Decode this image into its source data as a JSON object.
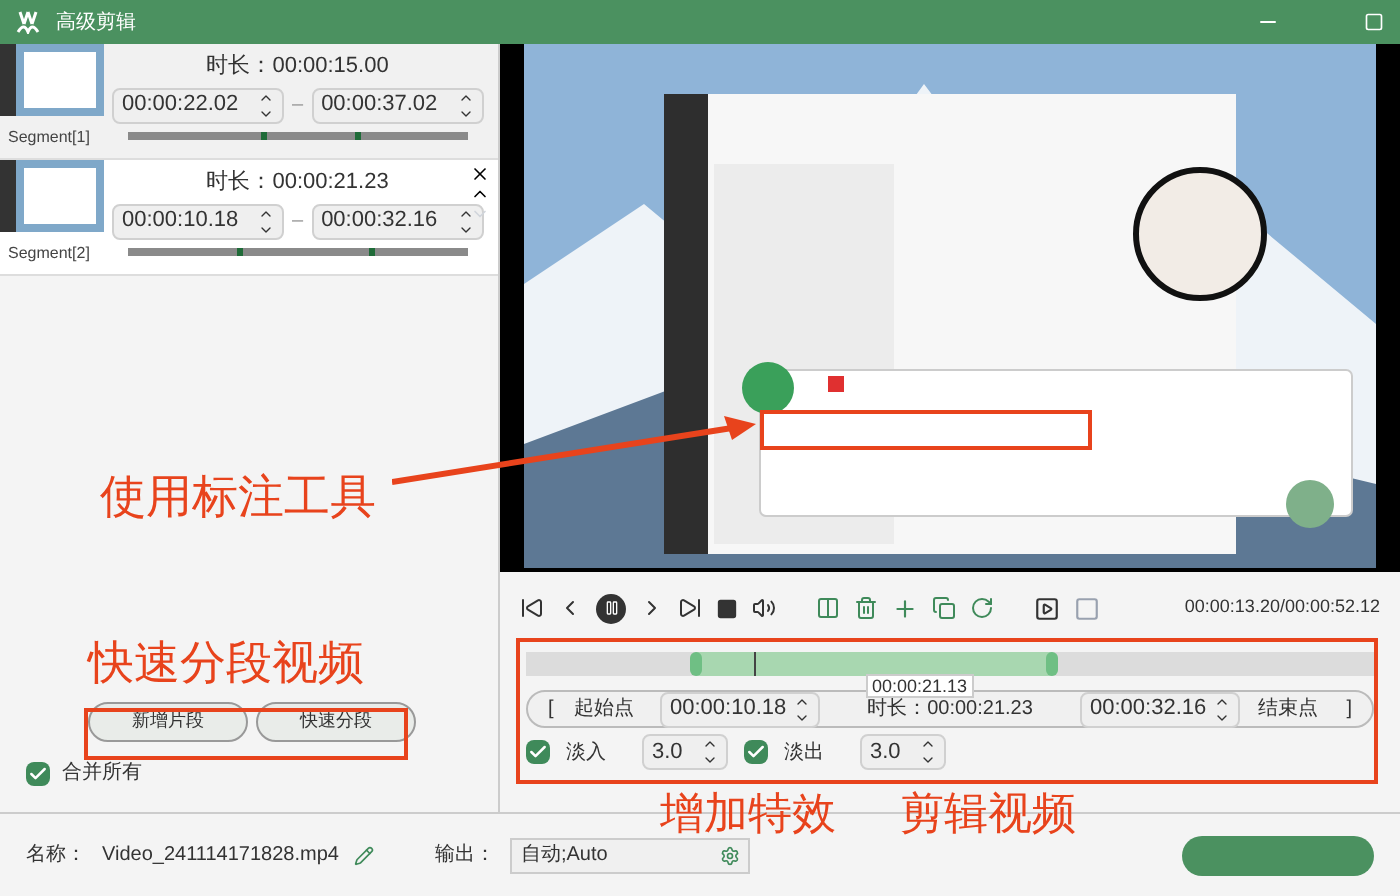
{
  "window": {
    "title": "高级剪辑"
  },
  "segments": [
    {
      "label": "Segment[1]",
      "duration_label": "时长：",
      "duration": "00:00:15.00",
      "start": "00:00:22.02",
      "separator": "–",
      "end": "00:00:37.02",
      "selected": false,
      "range": [
        {
          "level": 0.4
        },
        {
          "level": 0.68
        }
      ]
    },
    {
      "label": "Segment[2]",
      "duration_label": "时长：",
      "duration": "00:00:21.23",
      "start": "00:00:10.18",
      "separator": "–",
      "end": "00:00:32.16",
      "selected": true,
      "range": [
        {
          "level": 0.33
        },
        {
          "level": 0.72
        }
      ]
    }
  ],
  "segment_buttons": [
    "新增片段",
    "快速分段"
  ],
  "merge_all": {
    "label": "合并所有",
    "checked": true
  },
  "player": {
    "time": "00:00:13.20/00:00:52.12"
  },
  "timeline": {
    "handles": [
      {
        "level": 0.2
      },
      {
        "level": 0.62
      }
    ],
    "playhead": {
      "level": 0.27
    },
    "tooltip": "00:00:21.13",
    "start_mark": "[",
    "start_label": "起始点",
    "start_time": "00:00:10.18",
    "duration_label": "时长：",
    "duration": "00:00:21.23",
    "end_time": "00:00:32.16",
    "end_label": "结束点",
    "end_mark": "]"
  },
  "fades": [
    {
      "label": "淡入",
      "checked": true,
      "value": "3.0"
    },
    {
      "label": "淡出",
      "checked": true,
      "value": "3.0"
    }
  ],
  "footer": {
    "name_label": "名称：",
    "file_name": "Video_241114171828.mp4",
    "output_label": "输出：",
    "output_value": "自动;Auto"
  },
  "annotations": [
    {
      "kind": "tools",
      "text": "使用标注工具"
    },
    {
      "kind": "split",
      "text": "快速分段视频"
    },
    {
      "kind": "effects",
      "text": "增加特效"
    },
    {
      "kind": "trim",
      "text": "剪辑视频"
    }
  ]
}
